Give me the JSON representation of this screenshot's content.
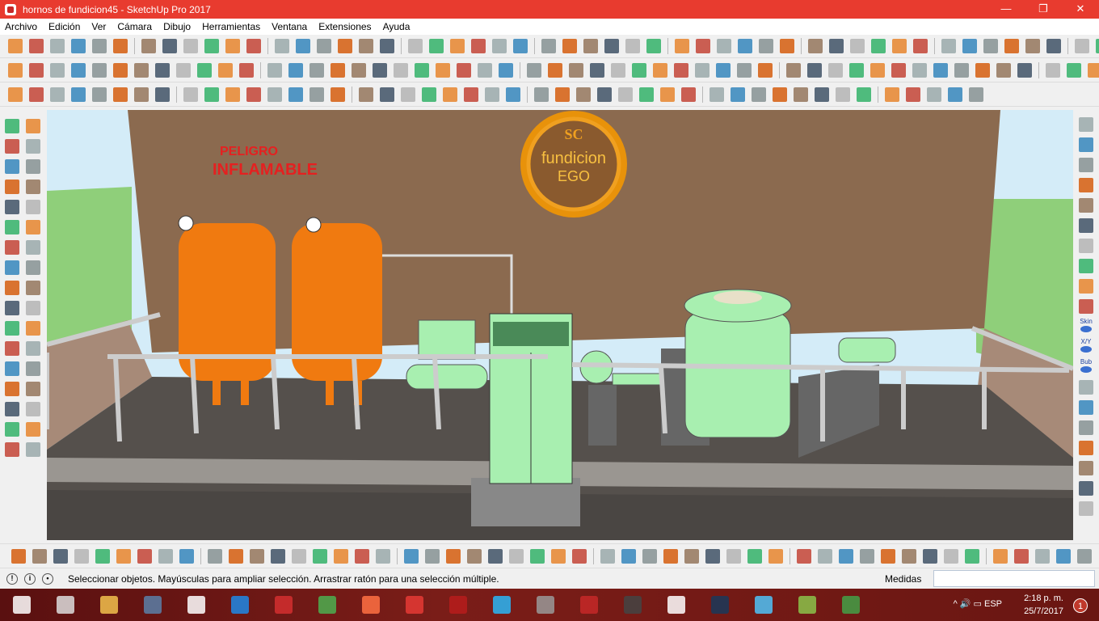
{
  "window": {
    "title": "hornos de fundicion45 - SketchUp Pro 2017",
    "minimize": "—",
    "maximize": "❐",
    "close": "✕"
  },
  "menu": [
    "Archivo",
    "Edición",
    "Ver",
    "Cámara",
    "Dibujo",
    "Herramientas",
    "Ventana",
    "Extensiones",
    "Ayuda"
  ],
  "scene": {
    "warning_line1": "PELIGRO",
    "warning_line2": "INFLAMABLE",
    "logo_top": "SC",
    "logo_mid": "fundicion",
    "logo_bottom": "EGO"
  },
  "right_toolbar_labels": [
    "Skin",
    "X/Y",
    "Bub"
  ],
  "status": {
    "message": "Seleccionar objetos. Mayúsculas para ampliar selección. Arrastrar ratón para una selección múltiple.",
    "measures_label": "Medidas",
    "measures_value": ""
  },
  "taskbar": {
    "language": "ESP",
    "time": "2:18 p. m.",
    "date": "25/7/2017",
    "notifications": "1"
  },
  "colors": {
    "title_bar": "#e83b2f",
    "wall": "#8a6a50",
    "tank": "#f07a10",
    "machine": "#a8efb0"
  }
}
